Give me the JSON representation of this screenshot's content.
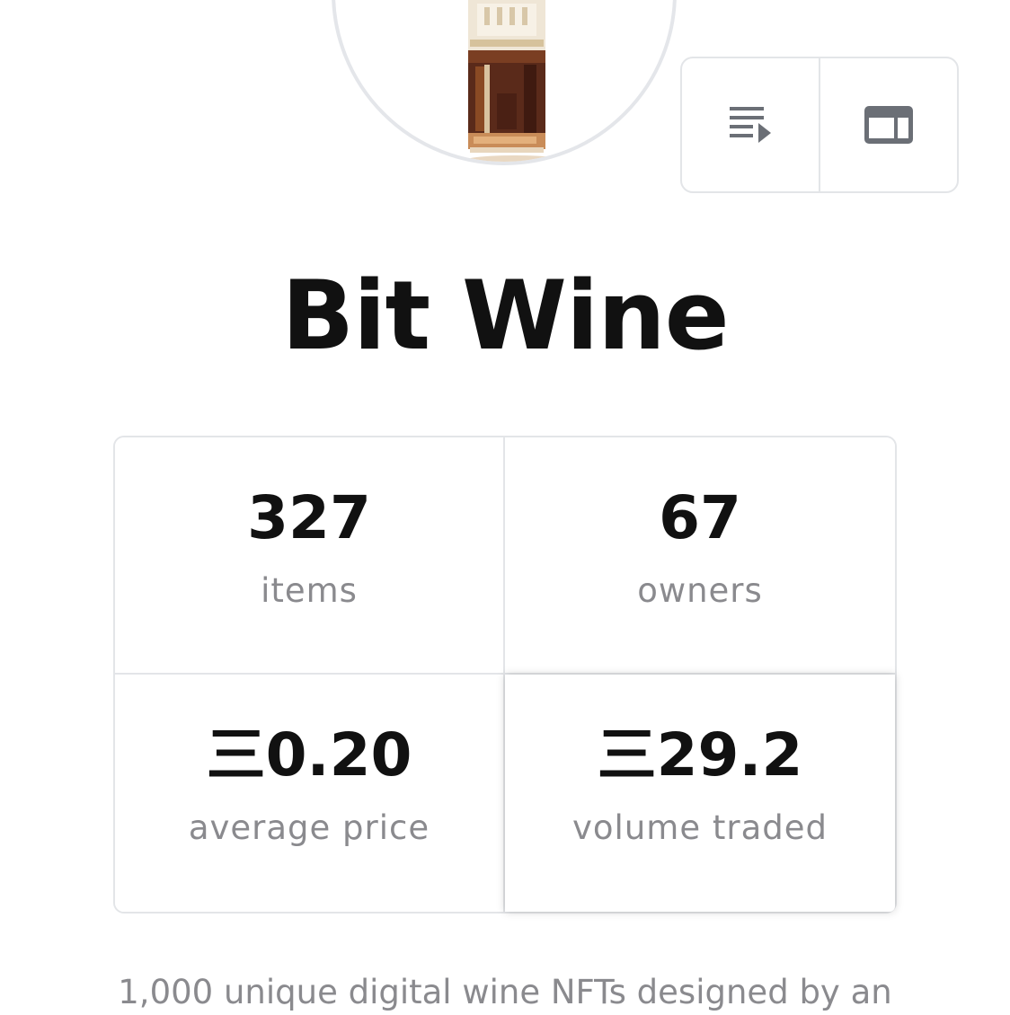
{
  "collection": {
    "title": "Bit Wine",
    "avatar_icon": "wine-bottle-pixel-art",
    "description": "1,000 unique digital wine NFTs designed by an"
  },
  "view_toggle": {
    "list_icon": "playlist-icon",
    "grid_icon": "web-layout-icon"
  },
  "stats": [
    {
      "value": "327",
      "label": "items"
    },
    {
      "value": "67",
      "label": "owners"
    },
    {
      "value": "三0.20",
      "label": "average price"
    },
    {
      "value": "三29.2",
      "label": "volume traded"
    }
  ],
  "colors": {
    "border": "#e3e5e8",
    "label_gray": "#8a8a8e",
    "text": "#111111",
    "icon_gray": "#6b6f76"
  }
}
